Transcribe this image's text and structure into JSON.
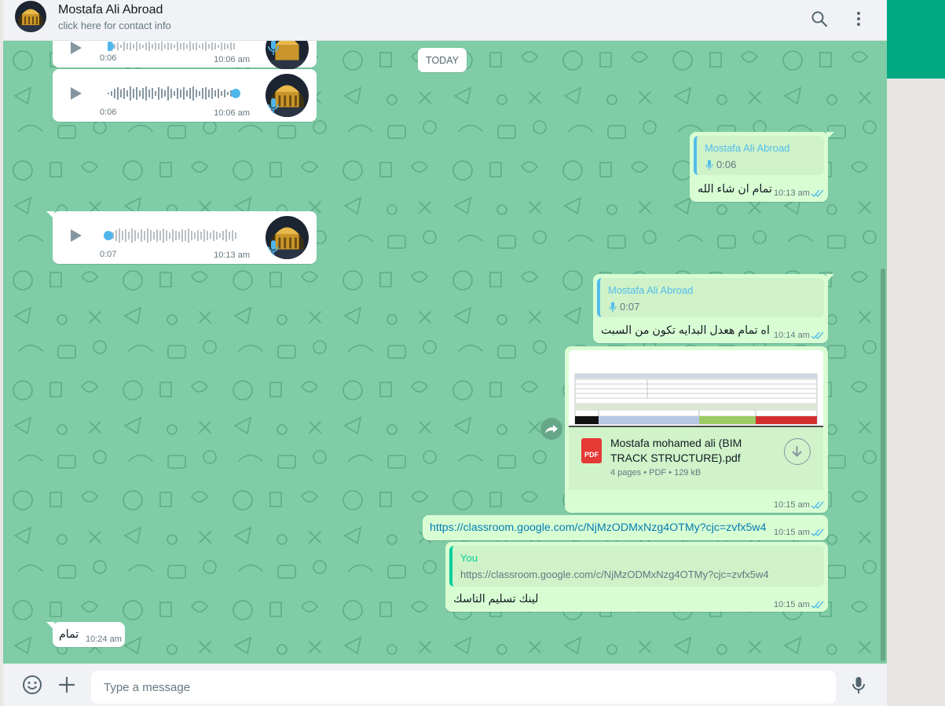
{
  "header": {
    "contact_name": "Mostafa Ali Abroad",
    "subtitle": "click here for contact info"
  },
  "icons": {
    "search": "search-icon",
    "menu": "kebab-menu-icon",
    "emoji": "emoji-icon",
    "attach": "plus-icon",
    "mic": "microphone-icon"
  },
  "colors": {
    "wallpaper": "#7fcca6",
    "incoming": "#ffffff",
    "outgoing": "#d9fdd3",
    "accent": "#00a884",
    "link": "#027eb5"
  },
  "chat": {
    "date_divider": "TODAY",
    "messages": [
      {
        "type": "voice",
        "direction": "in",
        "duration": "0:06",
        "time": "10:06 am",
        "progress": 0.0
      },
      {
        "type": "voice",
        "direction": "in",
        "duration": "0:06",
        "time": "10:06 am",
        "progress": 1.0
      },
      {
        "type": "reply",
        "direction": "out",
        "quote_author": "Mostafa Ali Abroad",
        "quote_duration": "0:06",
        "text": "تمام ان شاء الله",
        "time": "10:13 am"
      },
      {
        "type": "voice",
        "direction": "in",
        "duration": "0:07",
        "time": "10:13 am",
        "progress": 0.0
      },
      {
        "type": "reply",
        "direction": "out",
        "quote_author": "Mostafa Ali Abroad",
        "quote_duration": "0:07",
        "text": "اه تمام هعدل البدايه تكون من السبت",
        "time": "10:14 am"
      },
      {
        "type": "document",
        "direction": "out",
        "file_name": "Mostafa mohamed ali (BIM TRACK STRUCTURE).pdf",
        "file_badge": "PDF",
        "meta": "4 pages • PDF • 129 kB",
        "time": "10:15 am"
      },
      {
        "type": "link",
        "direction": "out",
        "text": "https://classroom.google.com/c/NjMzODMxNzg4OTMy?cjc=zvfx5w4",
        "time": "10:15 am"
      },
      {
        "type": "reply",
        "direction": "out",
        "quote_author": "You",
        "quote_text": "https://classroom.google.com/c/NjMzODMxNzg4OTMy?cjc=zvfx5w4",
        "text": "لينك تسليم التاسك",
        "time": "10:15 am"
      },
      {
        "type": "text",
        "direction": "in",
        "text": "تمام",
        "time": "10:24 am"
      }
    ]
  },
  "composer": {
    "placeholder": "Type a message"
  }
}
